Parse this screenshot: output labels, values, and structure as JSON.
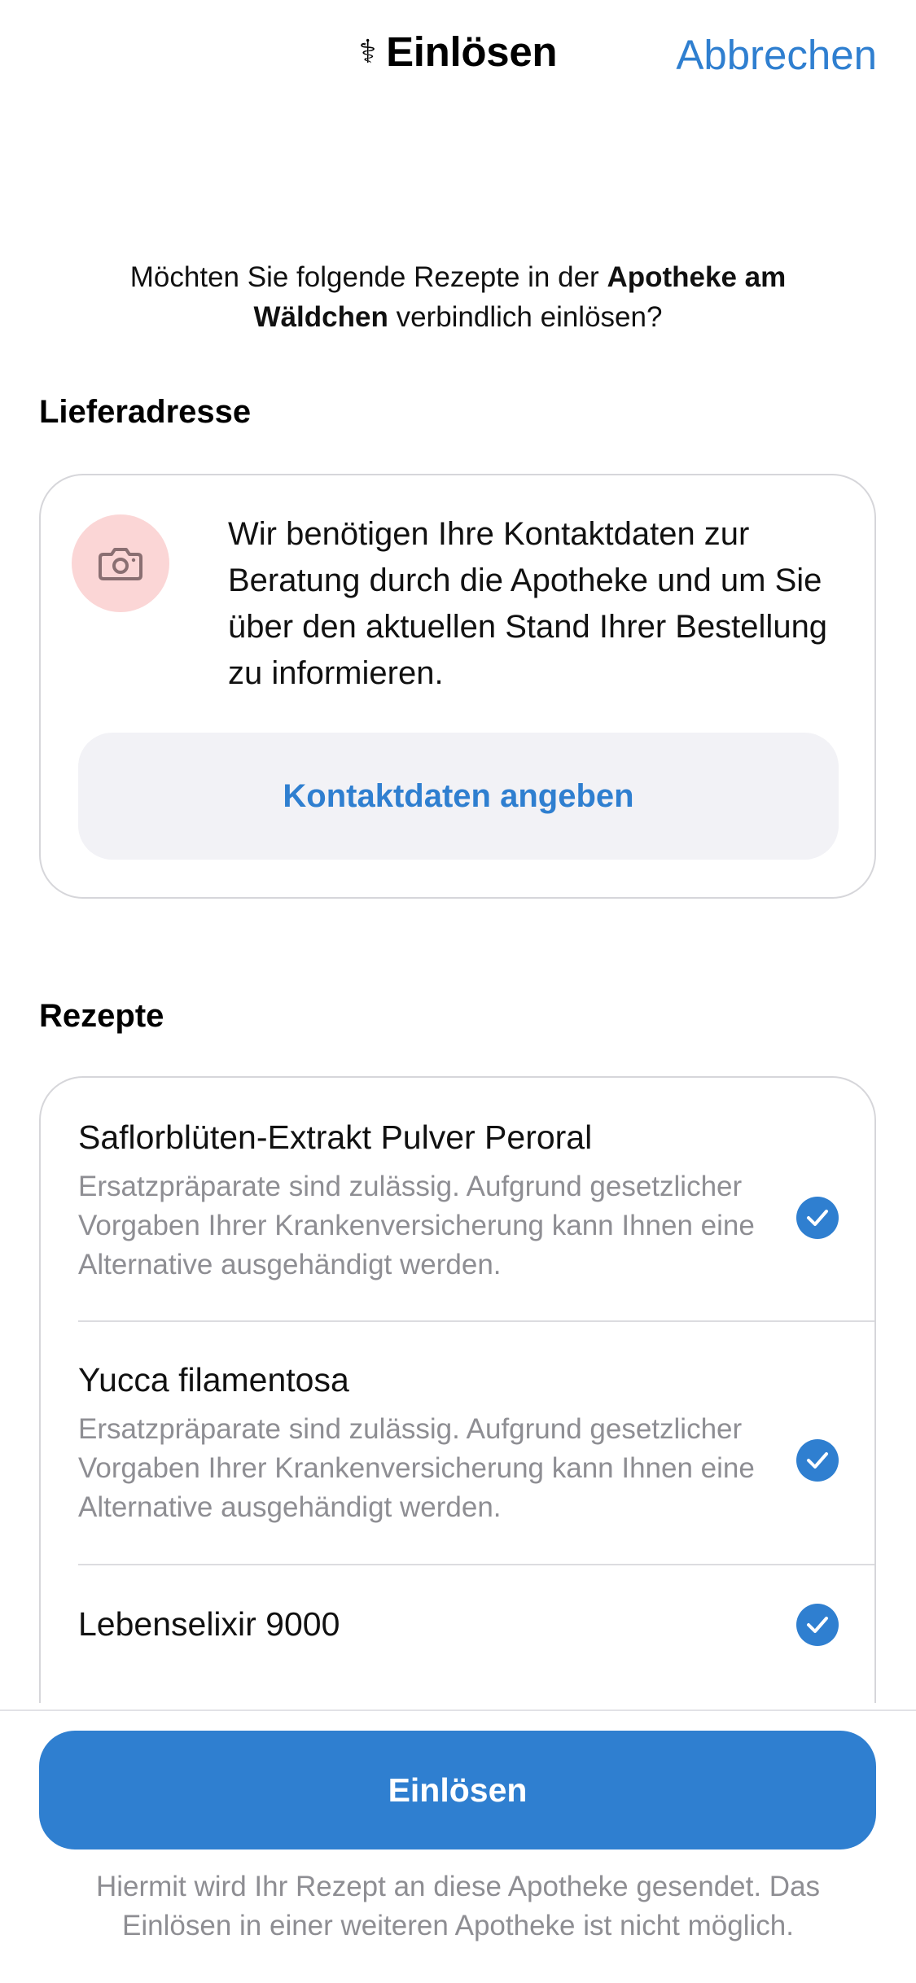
{
  "navbar": {
    "title_icon": "⚕",
    "title": "Einlösen",
    "cancel_label": "Abbrechen"
  },
  "intro": {
    "prefix": "Möchten Sie folgende Rezepte in der ",
    "pharmacy": "Apotheke am Wäldchen",
    "suffix": " verbindlich einlösen?"
  },
  "address": {
    "section_title": "Lieferadresse",
    "icon": "camera-icon",
    "text": "Wir benötigen Ihre Kontaktdaten zur Beratung durch die Apotheke und um Sie über den aktuellen Stand Ihrer Bestellung zu informieren.",
    "button_label": "Kontaktdaten angeben"
  },
  "prescriptions": {
    "section_title": "Rezepte",
    "items": [
      {
        "name": "Saflorblüten-Extrakt Pulver Peroral",
        "description": "Ersatzpräparate sind zulässig. Aufgrund gesetzlicher Vorgaben Ihrer Krankenversicherung kann Ihnen eine Alternative ausgehändigt werden.",
        "selected": true
      },
      {
        "name": "Yucca filamentosa",
        "description": "Ersatzpräparate sind zulässig. Aufgrund gesetzlicher Vorgaben Ihrer Krankenversicherung kann Ihnen eine Alternative ausgehändigt werden.",
        "selected": true
      },
      {
        "name": "Lebenselixir 9000",
        "description": "",
        "selected": true
      }
    ]
  },
  "footer": {
    "redeem_label": "Einlösen",
    "note": "Hiermit wird Ihr Rezept an diese Apotheke gesendet. Das Einlösen in einer weiteren Apotheke ist nicht möglich."
  },
  "colors": {
    "accent": "#2f7fd0",
    "avatar_bg": "#fbd6d6",
    "secondary_text": "#8e8e93"
  }
}
